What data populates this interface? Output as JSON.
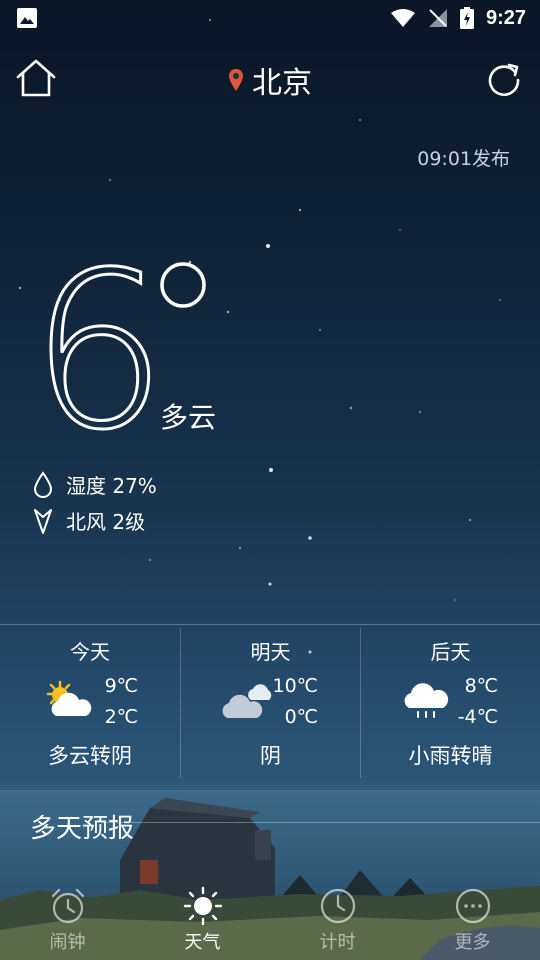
{
  "status_bar": {
    "time": "9:27"
  },
  "header": {
    "city": "北京"
  },
  "publish_time": "09:01发布",
  "current": {
    "temperature": "6",
    "condition": "多云",
    "humidity": "湿度 27%",
    "wind": "北风 2级"
  },
  "days": [
    {
      "label": "今天",
      "high": "9℃",
      "low": "2℃",
      "condition": "多云转阴",
      "icon": "partly-cloudy-icon"
    },
    {
      "label": "明天",
      "high": "10℃",
      "low": "0℃",
      "condition": "阴",
      "icon": "cloudy-icon"
    },
    {
      "label": "后天",
      "high": "8℃",
      "low": "-4℃",
      "condition": "小雨转晴",
      "icon": "light-rain-icon"
    }
  ],
  "forecast": {
    "title": "多天预报"
  },
  "nav": [
    {
      "label": "闹钟",
      "icon": "alarm-clock-icon"
    },
    {
      "label": "天气",
      "icon": "sun-icon"
    },
    {
      "label": "计时",
      "icon": "timer-icon"
    },
    {
      "label": "更多",
      "icon": "more-icon"
    }
  ],
  "colors": {
    "accent": "#ffffff",
    "location_pin": "#e0543a",
    "sun": "#f5c020"
  }
}
